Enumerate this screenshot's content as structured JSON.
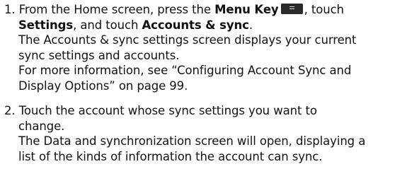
{
  "steps": [
    {
      "number": "1.",
      "lines": {
        "a1": "From the Home screen, press the ",
        "a2": "Menu Key",
        "a3": ", touch",
        "b1": "Settings",
        "b2": ", and touch ",
        "b3": "Accounts & sync",
        "b4": ".",
        "c": "The Accounts & sync settings screen displays your current",
        "d": "sync settings and accounts.",
        "e": "For more information, see “Configuring Account Sync and",
        "f": "Display Options” on page 99."
      },
      "icon": "menu-key-icon"
    },
    {
      "number": "2.",
      "lines": {
        "a": "Touch the account whose sync settings you want to",
        "b": "change.",
        "c": "The Data and synchronization screen will open, displaying a",
        "d": "list of the kinds of information the account can sync."
      }
    }
  ]
}
